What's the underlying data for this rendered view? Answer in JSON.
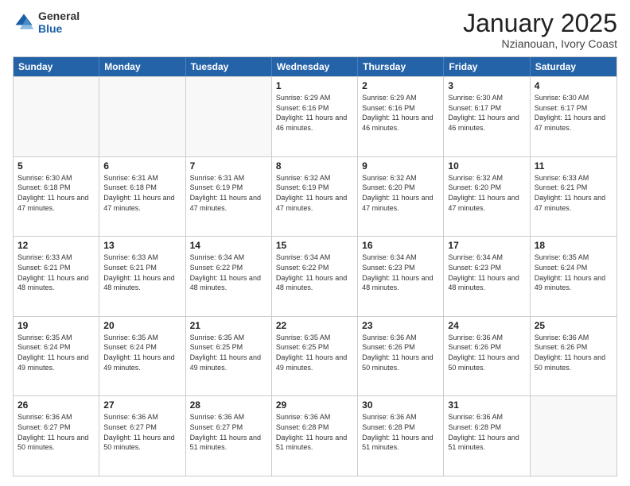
{
  "logo": {
    "general": "General",
    "blue": "Blue"
  },
  "title": "January 2025",
  "subtitle": "Nzianouan, Ivory Coast",
  "days": [
    "Sunday",
    "Monday",
    "Tuesday",
    "Wednesday",
    "Thursday",
    "Friday",
    "Saturday"
  ],
  "rows": [
    [
      {
        "day": "",
        "empty": true
      },
      {
        "day": "",
        "empty": true
      },
      {
        "day": "",
        "empty": true
      },
      {
        "day": "1",
        "sunrise": "6:29 AM",
        "sunset": "6:16 PM",
        "daylight": "11 hours and 46 minutes."
      },
      {
        "day": "2",
        "sunrise": "6:29 AM",
        "sunset": "6:16 PM",
        "daylight": "11 hours and 46 minutes."
      },
      {
        "day": "3",
        "sunrise": "6:30 AM",
        "sunset": "6:17 PM",
        "daylight": "11 hours and 46 minutes."
      },
      {
        "day": "4",
        "sunrise": "6:30 AM",
        "sunset": "6:17 PM",
        "daylight": "11 hours and 47 minutes."
      }
    ],
    [
      {
        "day": "5",
        "sunrise": "6:30 AM",
        "sunset": "6:18 PM",
        "daylight": "11 hours and 47 minutes."
      },
      {
        "day": "6",
        "sunrise": "6:31 AM",
        "sunset": "6:18 PM",
        "daylight": "11 hours and 47 minutes."
      },
      {
        "day": "7",
        "sunrise": "6:31 AM",
        "sunset": "6:19 PM",
        "daylight": "11 hours and 47 minutes."
      },
      {
        "day": "8",
        "sunrise": "6:32 AM",
        "sunset": "6:19 PM",
        "daylight": "11 hours and 47 minutes."
      },
      {
        "day": "9",
        "sunrise": "6:32 AM",
        "sunset": "6:20 PM",
        "daylight": "11 hours and 47 minutes."
      },
      {
        "day": "10",
        "sunrise": "6:32 AM",
        "sunset": "6:20 PM",
        "daylight": "11 hours and 47 minutes."
      },
      {
        "day": "11",
        "sunrise": "6:33 AM",
        "sunset": "6:21 PM",
        "daylight": "11 hours and 47 minutes."
      }
    ],
    [
      {
        "day": "12",
        "sunrise": "6:33 AM",
        "sunset": "6:21 PM",
        "daylight": "11 hours and 48 minutes."
      },
      {
        "day": "13",
        "sunrise": "6:33 AM",
        "sunset": "6:21 PM",
        "daylight": "11 hours and 48 minutes."
      },
      {
        "day": "14",
        "sunrise": "6:34 AM",
        "sunset": "6:22 PM",
        "daylight": "11 hours and 48 minutes."
      },
      {
        "day": "15",
        "sunrise": "6:34 AM",
        "sunset": "6:22 PM",
        "daylight": "11 hours and 48 minutes."
      },
      {
        "day": "16",
        "sunrise": "6:34 AM",
        "sunset": "6:23 PM",
        "daylight": "11 hours and 48 minutes."
      },
      {
        "day": "17",
        "sunrise": "6:34 AM",
        "sunset": "6:23 PM",
        "daylight": "11 hours and 48 minutes."
      },
      {
        "day": "18",
        "sunrise": "6:35 AM",
        "sunset": "6:24 PM",
        "daylight": "11 hours and 49 minutes."
      }
    ],
    [
      {
        "day": "19",
        "sunrise": "6:35 AM",
        "sunset": "6:24 PM",
        "daylight": "11 hours and 49 minutes."
      },
      {
        "day": "20",
        "sunrise": "6:35 AM",
        "sunset": "6:24 PM",
        "daylight": "11 hours and 49 minutes."
      },
      {
        "day": "21",
        "sunrise": "6:35 AM",
        "sunset": "6:25 PM",
        "daylight": "11 hours and 49 minutes."
      },
      {
        "day": "22",
        "sunrise": "6:35 AM",
        "sunset": "6:25 PM",
        "daylight": "11 hours and 49 minutes."
      },
      {
        "day": "23",
        "sunrise": "6:36 AM",
        "sunset": "6:26 PM",
        "daylight": "11 hours and 50 minutes."
      },
      {
        "day": "24",
        "sunrise": "6:36 AM",
        "sunset": "6:26 PM",
        "daylight": "11 hours and 50 minutes."
      },
      {
        "day": "25",
        "sunrise": "6:36 AM",
        "sunset": "6:26 PM",
        "daylight": "11 hours and 50 minutes."
      }
    ],
    [
      {
        "day": "26",
        "sunrise": "6:36 AM",
        "sunset": "6:27 PM",
        "daylight": "11 hours and 50 minutes."
      },
      {
        "day": "27",
        "sunrise": "6:36 AM",
        "sunset": "6:27 PM",
        "daylight": "11 hours and 50 minutes."
      },
      {
        "day": "28",
        "sunrise": "6:36 AM",
        "sunset": "6:27 PM",
        "daylight": "11 hours and 51 minutes."
      },
      {
        "day": "29",
        "sunrise": "6:36 AM",
        "sunset": "6:28 PM",
        "daylight": "11 hours and 51 minutes."
      },
      {
        "day": "30",
        "sunrise": "6:36 AM",
        "sunset": "6:28 PM",
        "daylight": "11 hours and 51 minutes."
      },
      {
        "day": "31",
        "sunrise": "6:36 AM",
        "sunset": "6:28 PM",
        "daylight": "11 hours and 51 minutes."
      },
      {
        "day": "",
        "empty": true
      }
    ]
  ],
  "labels": {
    "sunrise": "Sunrise:",
    "sunset": "Sunset:",
    "daylight": "Daylight:"
  }
}
